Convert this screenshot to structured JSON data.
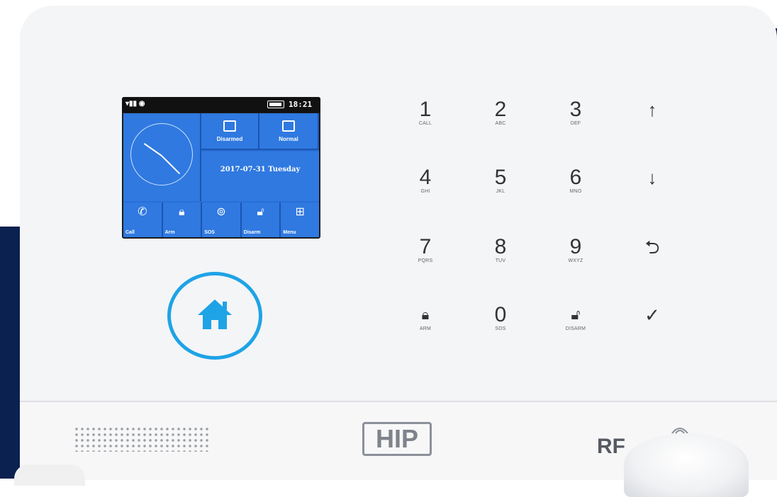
{
  "screen": {
    "status_time": "18:21",
    "tiles": [
      {
        "label": "Disarmed"
      },
      {
        "label": "Normal"
      }
    ],
    "date": "2017-07-31 Tuesday",
    "nav": [
      {
        "label": "Call",
        "icon": "phone-icon"
      },
      {
        "label": "Arm",
        "icon": "lock-icon"
      },
      {
        "label": "SOS",
        "icon": "sos-icon"
      },
      {
        "label": "Disarm",
        "icon": "unlock-icon"
      },
      {
        "label": "Menu",
        "icon": "menu-grid-icon"
      }
    ]
  },
  "keypad": {
    "k1": {
      "digit": "1",
      "sub": "CALL"
    },
    "k2": {
      "digit": "2",
      "sub": "ABC"
    },
    "k3": {
      "digit": "3",
      "sub": "DEF"
    },
    "k4": {
      "digit": "4",
      "sub": "GHI"
    },
    "k5": {
      "digit": "5",
      "sub": "JKL"
    },
    "k6": {
      "digit": "6",
      "sub": "MNO"
    },
    "k7": {
      "digit": "7",
      "sub": "PQRS"
    },
    "k8": {
      "digit": "8",
      "sub": "TUV"
    },
    "k9": {
      "digit": "9",
      "sub": "WXYZ"
    },
    "k0": {
      "digit": "0",
      "sub": "SOS"
    },
    "arm": {
      "sub": "ARM"
    },
    "disarm": {
      "sub": "DISARM"
    },
    "up": {
      "glyph": "↑"
    },
    "down": {
      "glyph": "↓"
    },
    "back": {
      "glyph": "⮌"
    },
    "ok": {
      "glyph": "✓"
    }
  },
  "branding": {
    "logo": "HIP",
    "rf": "RF"
  },
  "colors": {
    "accent": "#1ea3e6",
    "screen_blue": "#2f79e0",
    "frame_navy": "#0b2150"
  }
}
